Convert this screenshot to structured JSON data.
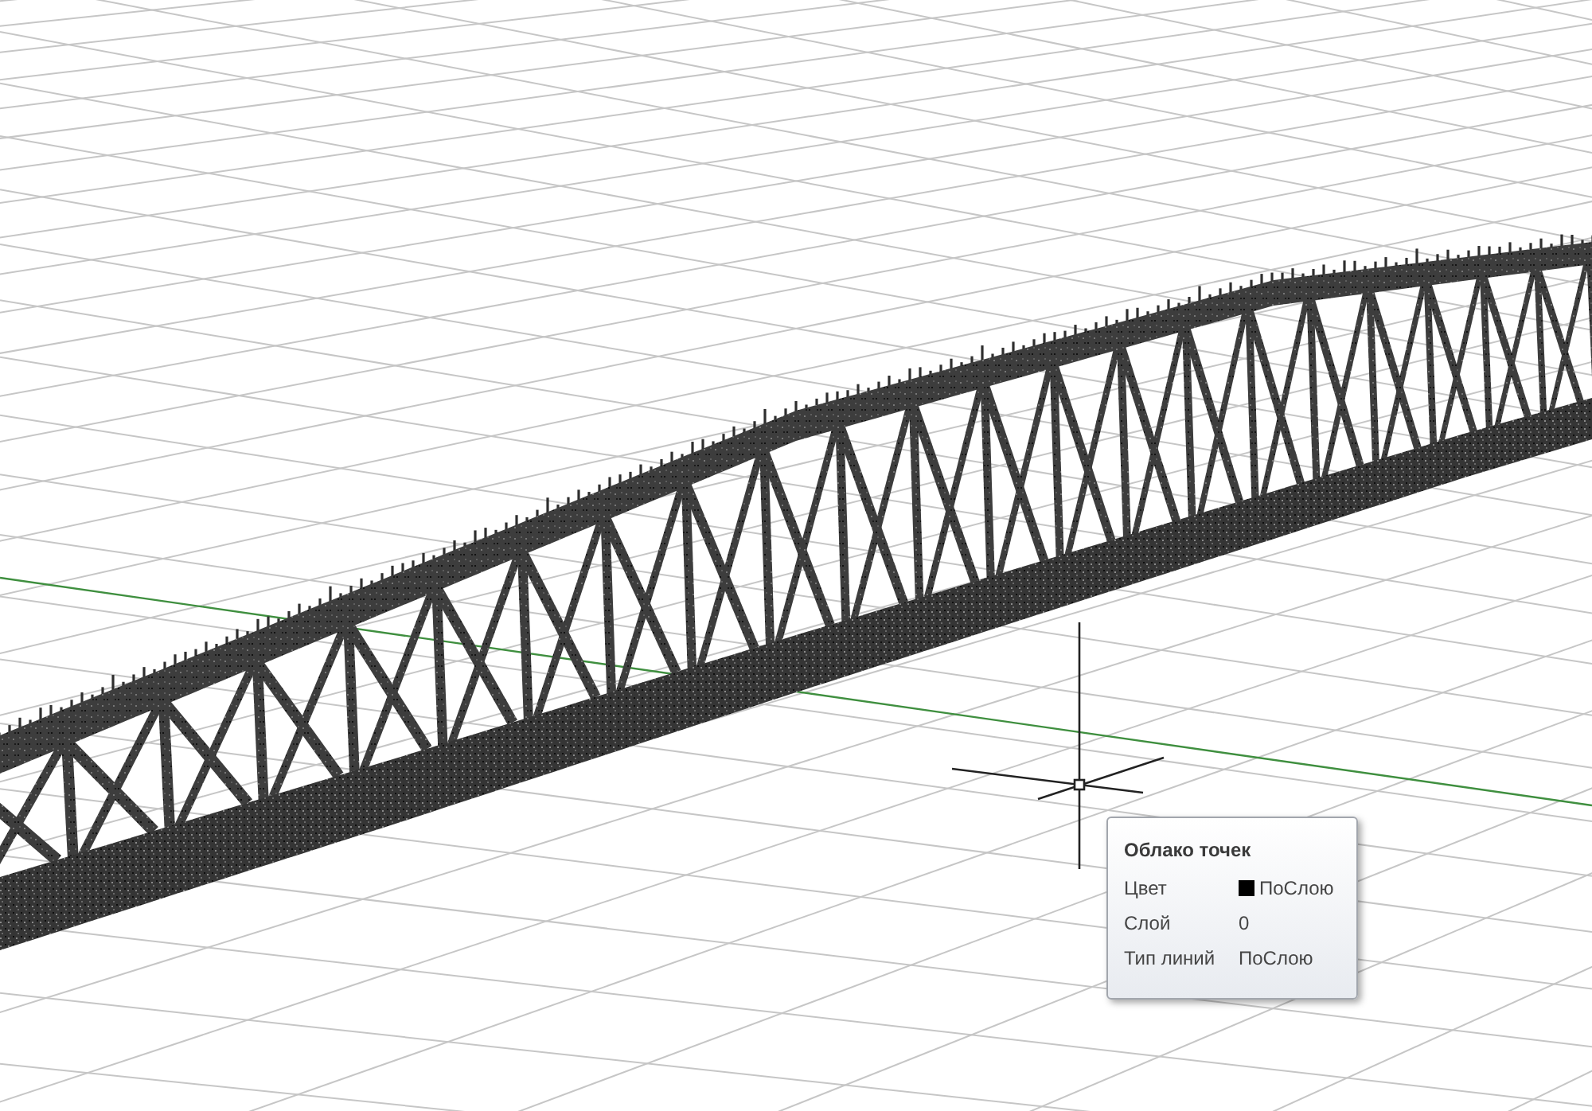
{
  "viewport": {
    "tooltip": {
      "title": "Облако точек",
      "rows": [
        {
          "kind": "color",
          "label": "Цвет",
          "value": "ПоСлою"
        },
        {
          "kind": "text",
          "label": "Слой",
          "value": "0"
        },
        {
          "kind": "text",
          "label": "Тип линий",
          "value": "ПоСлою"
        }
      ]
    }
  }
}
